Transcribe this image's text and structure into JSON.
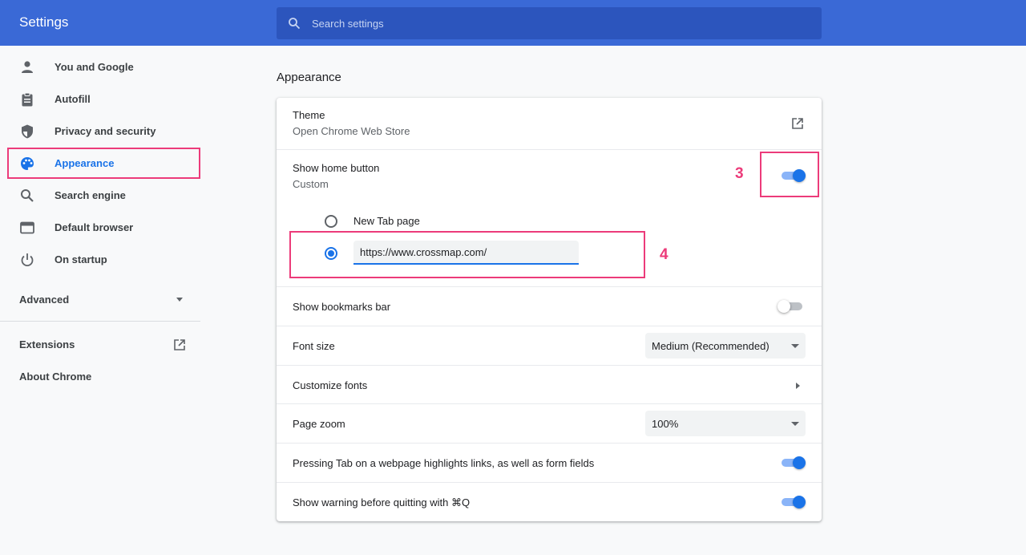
{
  "header": {
    "title": "Settings",
    "search_placeholder": "Search settings"
  },
  "sidebar": {
    "items": [
      {
        "label": "You and Google",
        "icon": "person-icon"
      },
      {
        "label": "Autofill",
        "icon": "clipboard-icon"
      },
      {
        "label": "Privacy and security",
        "icon": "shield-icon"
      },
      {
        "label": "Appearance",
        "icon": "palette-icon",
        "active": true
      },
      {
        "label": "Search engine",
        "icon": "search-icon"
      },
      {
        "label": "Default browser",
        "icon": "browser-window-icon"
      },
      {
        "label": "On startup",
        "icon": "power-icon"
      }
    ],
    "advanced_label": "Advanced",
    "extensions_label": "Extensions",
    "about_label": "About Chrome"
  },
  "main": {
    "section_title": "Appearance",
    "theme": {
      "label": "Theme",
      "sublabel": "Open Chrome Web Store",
      "icon": "open-in-new-icon"
    },
    "home_button": {
      "label": "Show home button",
      "sublabel": "Custom",
      "enabled": true,
      "options": [
        {
          "label": "New Tab page",
          "selected": false
        },
        {
          "value": "https://www.crossmap.com/",
          "selected": true
        }
      ]
    },
    "bookmarks_bar": {
      "label": "Show bookmarks bar",
      "enabled": false
    },
    "font_size": {
      "label": "Font size",
      "value": "Medium (Recommended)"
    },
    "customize_fonts": {
      "label": "Customize fonts"
    },
    "page_zoom": {
      "label": "Page zoom",
      "value": "100%"
    },
    "tab_highlight": {
      "label": "Pressing Tab on a webpage highlights links, as well as form fields",
      "enabled": true
    },
    "quit_warning": {
      "label": "Show warning before quitting with ⌘Q",
      "enabled": true
    }
  },
  "annotations": [
    {
      "number": "3"
    },
    {
      "number": "4"
    }
  ],
  "colors": {
    "header": "#3a69d6",
    "accent": "#1a73e8",
    "annotation": "#ec3b7a"
  }
}
